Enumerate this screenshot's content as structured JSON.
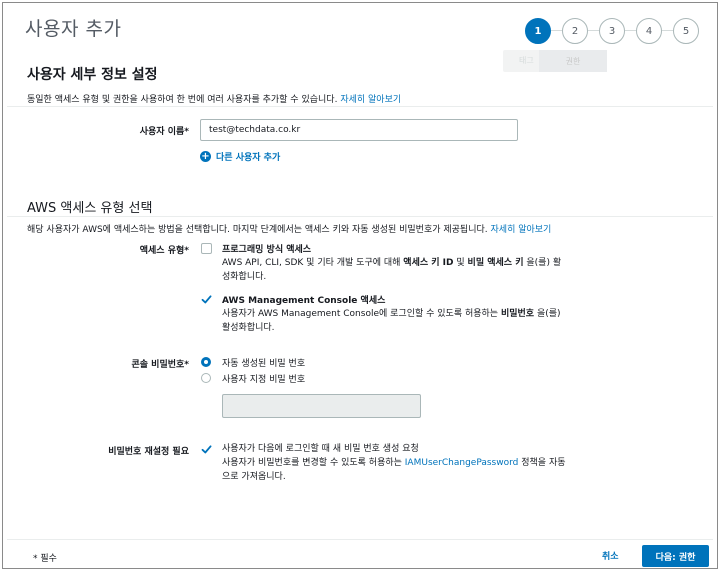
{
  "page": {
    "title": "사용자 추가"
  },
  "steps": [
    "1",
    "2",
    "3",
    "4",
    "5"
  ],
  "tooltip": {
    "left": "태그",
    "right": "권한"
  },
  "details": {
    "heading": "사용자 세부 정보 설정",
    "description": "동일한 액세스 유형 및 권한을 사용하여 한 번에 여러 사용자를 추가할 수 있습니다.",
    "learn_more": "자세히 알아보기",
    "username_label": "사용자 이름*",
    "username_value": "test@techdata.co.kr",
    "add_user_label": "다른 사용자 추가"
  },
  "access": {
    "heading": "AWS 액세스 유형 선택",
    "description": "해당 사용자가 AWS에 액세스하는 방법을 선택합니다. 마지막 단계에서는 액세스 키와 자동 생성된 비밀번호가 제공됩니다.",
    "learn_more": "자세히 알아보기",
    "type_label": "액세스 유형*",
    "programmatic": {
      "title": "프로그래밍 방식 액세스",
      "desc_1": "AWS API, CLI, SDK 및 기타 개발 도구에 대해",
      "desc_bold_1": "액세스 키 ID",
      "desc_2": "및",
      "desc_bold_2": "비밀 액세스 키",
      "desc_3": "을(를) 활",
      "desc_line2": "성화합니다."
    },
    "console": {
      "title": "AWS Management Console 액세스",
      "desc_1": "사용자가 AWS Management Console에 로그인할 수 있도록 허용하는",
      "desc_bold": "비밀번호",
      "desc_2": "을(를)",
      "desc_line2": "활성화합니다."
    }
  },
  "password": {
    "label": "콘솔 비밀번호*",
    "auto_option": "자동 생성된 비밀 번호",
    "custom_option": "사용자 지정 비밀 번호",
    "reset_label": "비밀번호 재설정 필요",
    "reset_desc_line1": "사용자가 다음에 로그인할 때 새 비밀 번호 생성 요청",
    "reset_desc_2a": "사용자가 비밀번호를 변경할 수 있도록 허용하는",
    "reset_policy_link": "IAMUserChangePassword",
    "reset_desc_2b": "정책을 자동",
    "reset_desc_line3": "으로 가져옵니다."
  },
  "footer": {
    "required_note": "* 필수",
    "cancel_label": "취소",
    "next_label": "다음: 권한"
  },
  "colors": {
    "accent": "#0073bb",
    "text": "#16191f",
    "muted": "#545b64"
  }
}
